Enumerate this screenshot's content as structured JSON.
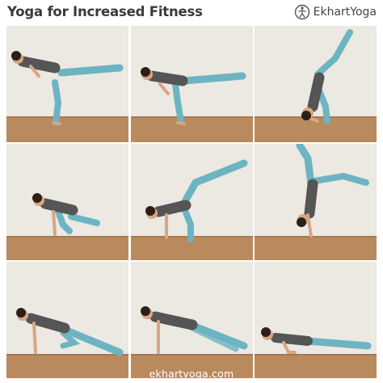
{
  "header": {
    "title": "Yoga for Increased Fitness",
    "brand": "EkhartYoga",
    "brand_icon": "ekhart-logo-icon"
  },
  "footer": {
    "url": "ekhartyoga.com"
  },
  "colors": {
    "wall": "#ebe7e1",
    "floor": "#b98a5e",
    "leggings": "#6cb4c2",
    "top": "#555555",
    "skin": "#d8a682",
    "hair": "#2b2019",
    "title": "#3a3a3a"
  },
  "poses": [
    "warrior-three-balance",
    "standing-split-forward-fold",
    "forearm-stand-split-entry",
    "crow-transition",
    "standing-split-hands-down",
    "handstand-split",
    "plank-knee-to-elbow",
    "three-legged-plank",
    "chaturanga-low-plank"
  ]
}
